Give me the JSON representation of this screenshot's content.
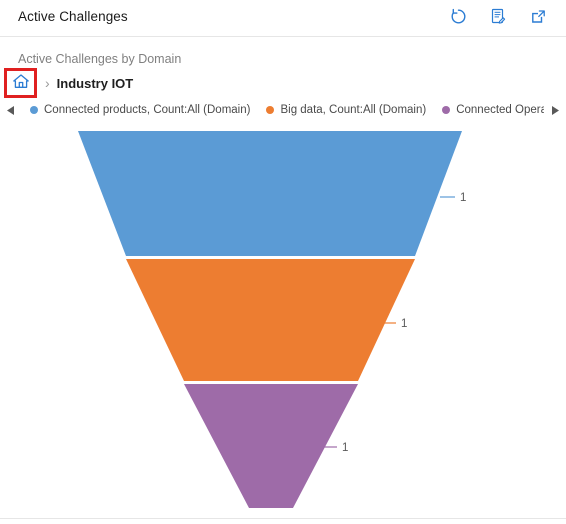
{
  "window": {
    "title": "Active Challenges",
    "actions": [
      {
        "name": "refresh-icon",
        "label": "Refresh"
      },
      {
        "name": "export-report-icon",
        "label": "Export"
      },
      {
        "name": "popout-icon",
        "label": "Open in new window"
      }
    ]
  },
  "chart": {
    "title": "Active Challenges by Domain",
    "breadcrumb": {
      "home_label": "Home",
      "separator": "›",
      "current": "Industry IOT"
    },
    "legend": {
      "prev_label": "◀",
      "next_label": "▶",
      "items": [
        {
          "label": "Connected products, Count:All (Domain)",
          "color": "#5B9BD5"
        },
        {
          "label": "Big data, Count:All (Domain)",
          "color": "#ED7D31"
        },
        {
          "label": "Connected Opera",
          "color": "#9E6BA8"
        }
      ]
    }
  },
  "chart_data": {
    "type": "funnel",
    "title": "Active Challenges by Domain",
    "xlabel": "",
    "ylabel": "",
    "grid": false,
    "legend_position": "top",
    "categories": [
      "Connected products, Count:All (Domain)",
      "Big data, Count:All (Domain)",
      "Connected Opera"
    ],
    "values": [
      1,
      1,
      1
    ],
    "labels": [
      "1",
      "1",
      "1"
    ],
    "colors": [
      "#5B9BD5",
      "#ED7D31",
      "#9E6BA8"
    ],
    "series": [
      {
        "name": "Count:All (Domain)",
        "values": [
          1,
          1,
          1
        ]
      }
    ]
  },
  "colors": {
    "accent": "#2b7cd3",
    "highlight_box": "#e02020",
    "segment_1": "#5B9BD5",
    "segment_2": "#ED7D31",
    "segment_3": "#9E6BA8",
    "text": "#333333",
    "muted_text": "#808080"
  }
}
